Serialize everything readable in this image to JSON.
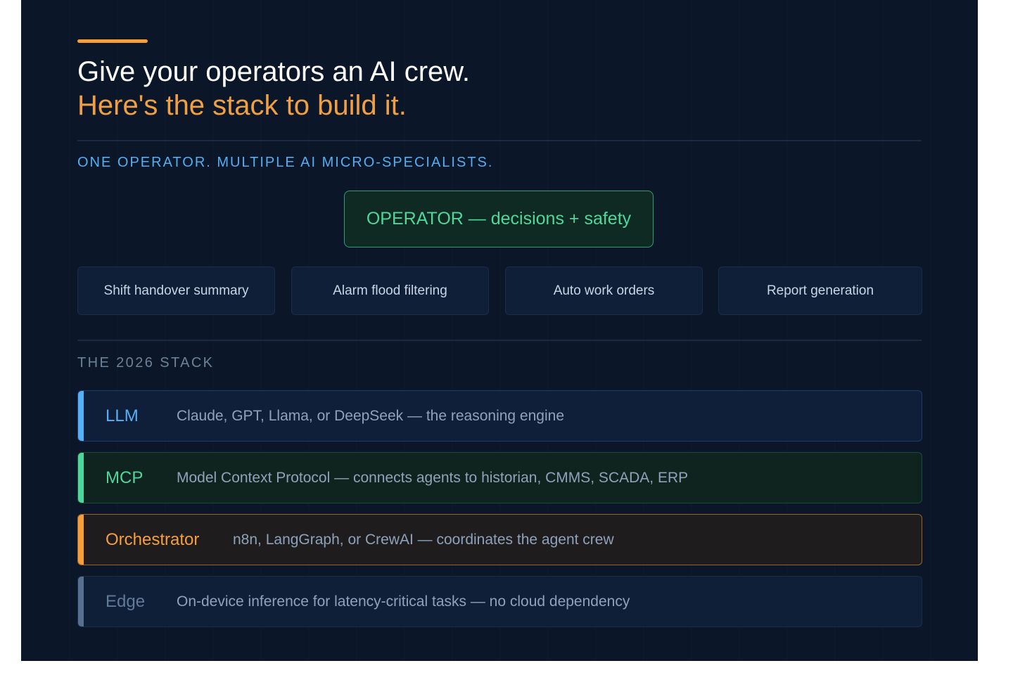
{
  "header": {
    "title_line1": "Give your operators an AI crew.",
    "title_line2": "Here's the stack to build it."
  },
  "crew": {
    "subtitle": "ONE OPERATOR. MULTIPLE AI MICRO-SPECIALISTS.",
    "operator_label": "OPERATOR — decisions + safety",
    "specialists": [
      "Shift handover summary",
      "Alarm flood filtering",
      "Auto work orders",
      "Report generation"
    ]
  },
  "stack": {
    "heading": "THE 2026 STACK",
    "layers": [
      {
        "name": "LLM",
        "description": "Claude, GPT, Llama, or DeepSeek — the reasoning engine",
        "color": "#55b0f5"
      },
      {
        "name": "MCP",
        "description": "Model Context Protocol — connects agents to historian, CMMS, SCADA, ERP",
        "color": "#4ed79a"
      },
      {
        "name": "Orchestrator",
        "description": "n8n, LangGraph, or CrewAI — coordinates the agent crew",
        "color": "#f59e3a"
      },
      {
        "name": "Edge",
        "description": "On-device inference for latency-critical tasks — no cloud dependency",
        "color": "#55718f"
      }
    ]
  },
  "colors": {
    "background": "#0b1629",
    "accent_orange": "#f0a043",
    "accent_blue": "#53aef2",
    "accent_green": "#4ed79a"
  }
}
